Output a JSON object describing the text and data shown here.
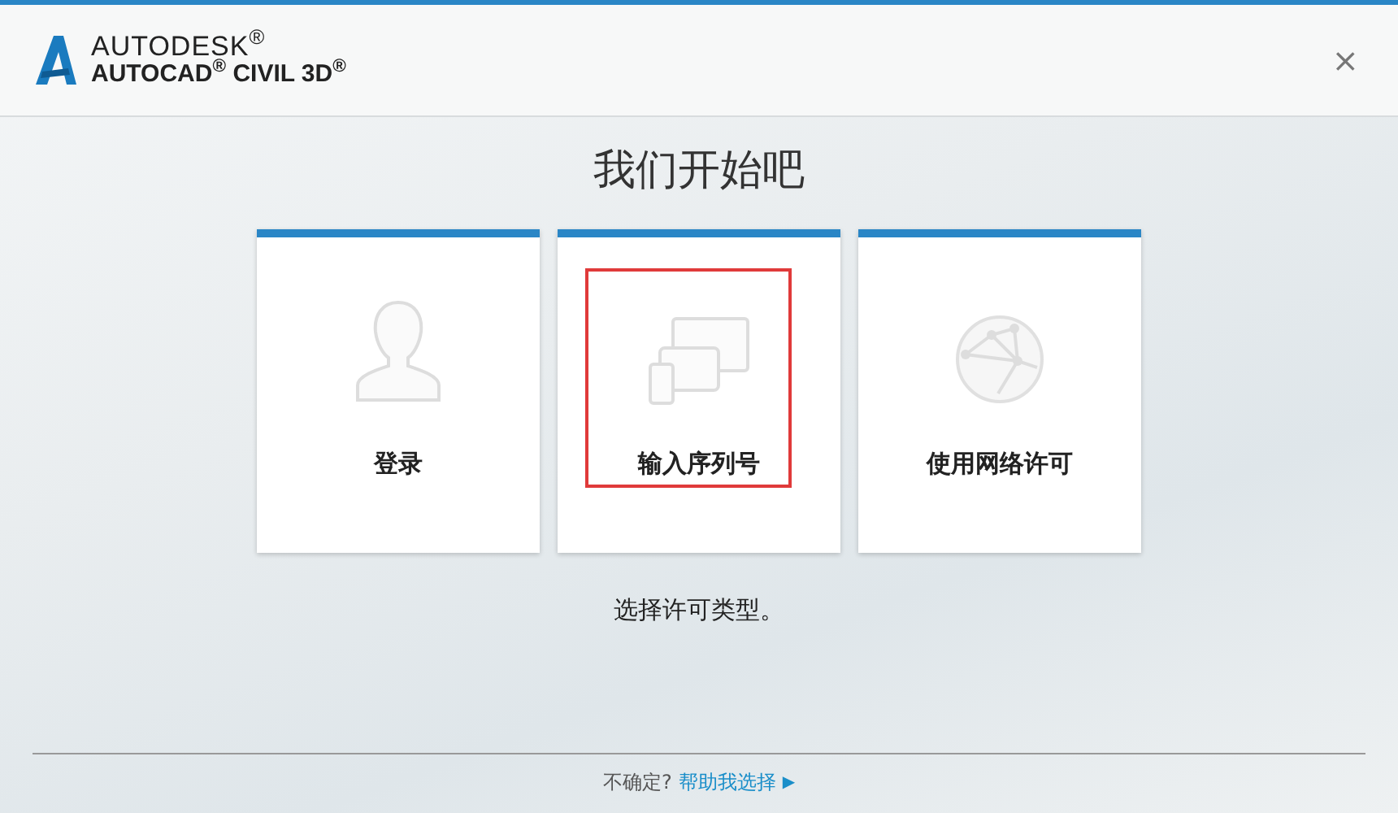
{
  "header": {
    "brand": "AUTODESK$^{®}$",
    "product": "AUTOCAD$^{®}$ CIVIL 3D$^{®}$",
    "close": "×"
  },
  "title": "我们开始吧",
  "options": [
    {
      "kind": "user",
      "label": "登录",
      "highlighted": false
    },
    {
      "kind": "devices",
      "label": "输入序列号",
      "highlighted": true
    },
    {
      "kind": "network",
      "label": "使用网络许可",
      "highlighted": false
    }
  ],
  "prompt": "选择许可类型。",
  "footer": {
    "question": "不确定?",
    "link": "帮助我选择",
    "arrow": "▶"
  }
}
